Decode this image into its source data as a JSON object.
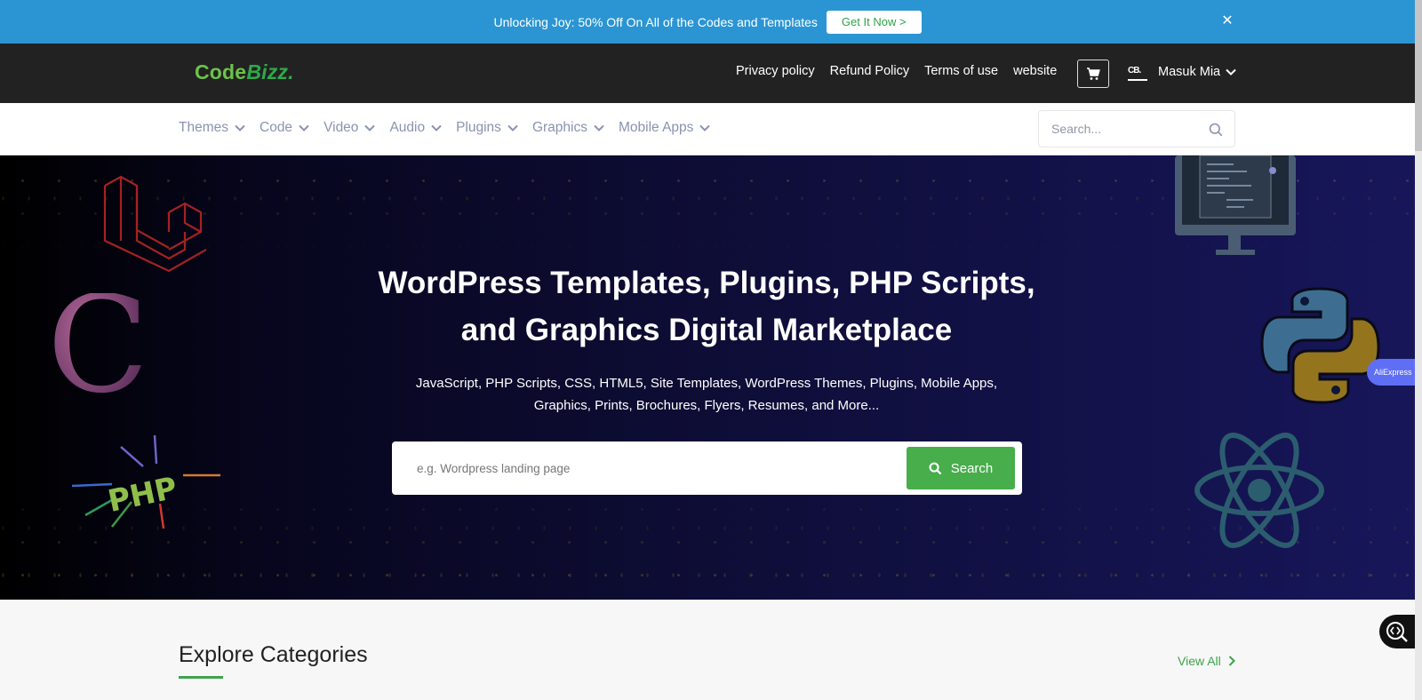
{
  "promo": {
    "text": "Unlocking Joy: 50% Off On All of the Codes and Templates",
    "button": "Get It Now >",
    "close_glyph": "✕"
  },
  "header": {
    "logo_main": "Code",
    "logo_accent": "Bizz.",
    "links": [
      "Privacy policy",
      "Refund Policy",
      "Terms of use",
      "website"
    ],
    "cart_icon": "cart-icon",
    "avatar_text": "CB.",
    "user_name": "Masuk Mia"
  },
  "nav": {
    "items": [
      "Themes",
      "Code",
      "Video",
      "Audio",
      "Plugins",
      "Graphics",
      "Mobile Apps"
    ],
    "search_placeholder": "Search..."
  },
  "hero": {
    "title": "WordPress Templates, Plugins, PHP Scripts, and Graphics Digital Marketplace",
    "subtitle": "JavaScript, PHP Scripts, CSS, HTML5, Site Templates, WordPress Themes, Plugins, Mobile Apps, Graphics, Prints, Brochures, Flyers, Resumes, and More...",
    "search_placeholder": "e.g. Wordpress landing page",
    "search_button": "Search",
    "decor": [
      "laravel-logo",
      "c-language-logo",
      "php-logo",
      "monitor-code-illustration",
      "python-logo",
      "react-logo"
    ]
  },
  "extension_badge": "AliExpress",
  "categories": {
    "title": "Explore Categories",
    "view_all": "View All"
  },
  "colors": {
    "promo_bg": "#2b95d3",
    "topbar_bg": "#222222",
    "accent_green": "#48ad4b",
    "nav_text": "#8a93b0"
  }
}
